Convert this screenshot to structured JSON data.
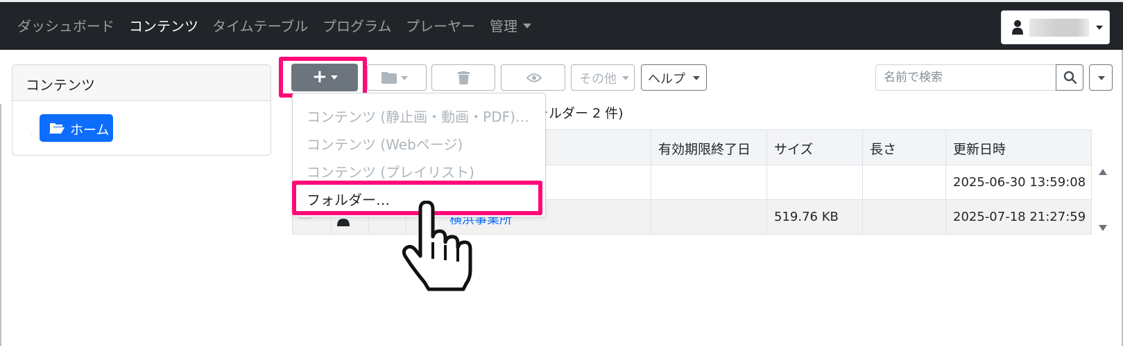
{
  "navbar": {
    "items": [
      {
        "label": "ダッシュボード"
      },
      {
        "label": "コンテンツ"
      },
      {
        "label": "タイムテーブル"
      },
      {
        "label": "プログラム"
      },
      {
        "label": "プレーヤー"
      },
      {
        "label": "管理"
      }
    ],
    "active_index": 1
  },
  "sidebar": {
    "title": "コンテンツ",
    "home_button": "ホーム"
  },
  "toolbar": {
    "other_label": "その他",
    "help_label": "ヘルプ",
    "search_placeholder": "名前で検索"
  },
  "dropdown": {
    "items": [
      {
        "label": "コンテンツ (静止画・動画・PDF)…",
        "enabled": false
      },
      {
        "label": "コンテンツ (Webページ)",
        "enabled": false
      },
      {
        "label": "コンテンツ (プレイリスト)",
        "enabled": false
      },
      {
        "label": "フォルダー…",
        "enabled": true
      }
    ]
  },
  "summary": "ォルダー 2 件)",
  "summary_lead": "·",
  "table": {
    "columns": [
      "有効期限終了日",
      "サイズ",
      "長さ",
      "更新日時"
    ],
    "rows": [
      {
        "name": "",
        "expiry": "",
        "size": "",
        "length": "",
        "updated": "2025-06-30 13:59:08"
      },
      {
        "name": "横浜事業所",
        "expiry": "",
        "size": "519.76 KB",
        "length": "",
        "updated": "2025-07-18 21:27:59"
      }
    ]
  },
  "colors": {
    "navbar": "#212529",
    "primary": "#0d6efd",
    "secondary": "#6c757d",
    "highlight": "#ff0a78"
  },
  "icons": [
    "plus-icon",
    "folder-icon",
    "trash-icon",
    "eye-icon",
    "search-icon",
    "user-icon",
    "pointing-hand-cursor"
  ]
}
